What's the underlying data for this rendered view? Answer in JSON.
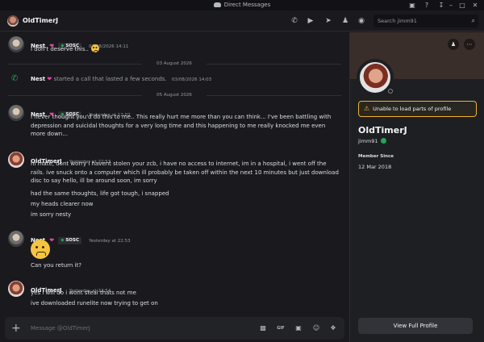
{
  "window": {
    "title": "Direct Messages",
    "controls": [
      "inbox-icon",
      "help-icon",
      "download-icon",
      "minimize-icon",
      "maximize-icon",
      "close-icon"
    ]
  },
  "header": {
    "name": "OldTimerJ",
    "icons": [
      "voice-call-icon",
      "video-call-icon",
      "pin-icon",
      "add-friends-icon",
      "user-profile-icon"
    ],
    "search_placeholder": "Search jimm91",
    "search_icon": "⌕"
  },
  "messages": [
    {
      "author": "Nest",
      "tag": "SOSC",
      "time": "02/08/2026 14:11",
      "lines": [
        "I don't deserve this.."
      ],
      "emoji": "slightly-frowning-face"
    },
    {
      "divider": "03 August 2026"
    },
    {
      "system": true,
      "author": "Nest",
      "text": "started a call that lasted a few seconds.",
      "time": "03/08/2026 14:03"
    },
    {
      "divider": "05 August 2026"
    },
    {
      "author": "Nest",
      "tag": "SOSC",
      "time": "Yesterday at 12:02",
      "lines": [
        "I never thought you'd do this to me.. This really hurt me more than you can think... I've been battling with depression and suicidal thoughts for a very long time and this happening to me really knocked me even more down..."
      ]
    },
    {
      "author": "OldTimerJ",
      "time": "Yesterday at 22:53",
      "lines": [
        "hi mate, dont worry i havent stolen your zcb, i have no access to internet, im in a hospital, i went off the rails. ive snuck onto a computer which ill probably be taken off within the next 10 minutes but just download disc to say hello, ill be around soon, im sorry",
        "had the same thoughts, life got tough, i snapped",
        "my heads clearer now",
        "im sorry nesty"
      ]
    },
    {
      "author": "Nest",
      "tag": "SOSC",
      "time": "Yesterday at 22:53",
      "lines": [
        "Can you return it?"
      ],
      "emoji": "slightly-frowning-face"
    },
    {
      "author": "OldTimerJ",
      "time": "Yesterday at 22:54",
      "lines": [
        "yes i will do i wont steal thats not me",
        "ive downloaded runelite now trying to get on"
      ]
    }
  ],
  "composer": {
    "placeholder": "Message @OldTimerJ",
    "icons": [
      "gift-icon",
      "gif-icon",
      "sticker-icon",
      "emoji-icon",
      "apps-icon"
    ]
  },
  "profile": {
    "warning": "Unable to load parts of profile",
    "display_name": "OldTimerJ",
    "username": "jimm91",
    "member_since_label": "Member Since",
    "member_since": "12 Mar 2018",
    "view_full": "View Full Profile",
    "status": "offline"
  },
  "colors": {
    "background": "#1a1a1e",
    "panel": "#1e1f22",
    "accent_green": "#23a55a",
    "heart_pink": "#eb459e",
    "warning_yellow": "#f0b232"
  }
}
